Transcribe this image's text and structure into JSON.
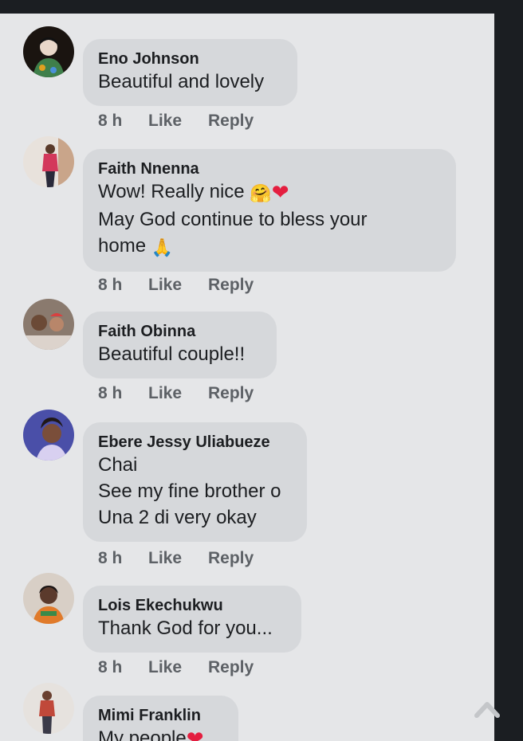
{
  "comments": [
    {
      "name": "Eno Johnson",
      "lines": [
        "Beautiful and lovely"
      ],
      "time": "8 h",
      "like": "Like",
      "reply": "Reply"
    },
    {
      "name": "Faith Nnenna",
      "lines": [
        "Wow! Really nice",
        "May God continue to bless your",
        "home"
      ],
      "time": "8 h",
      "like": "Like",
      "reply": "Reply"
    },
    {
      "name": "Faith Obinna",
      "lines": [
        "Beautiful couple!!"
      ],
      "time": "8 h",
      "like": "Like",
      "reply": "Reply"
    },
    {
      "name": "Ebere Jessy Uliabueze",
      "lines": [
        "Chai",
        "See my fine brother o",
        "Una 2 di very okay"
      ],
      "time": "8 h",
      "like": "Like",
      "reply": "Reply"
    },
    {
      "name": "Lois Ekechukwu",
      "lines": [
        "Thank God for you..."
      ],
      "time": "8 h",
      "like": "Like",
      "reply": "Reply"
    },
    {
      "name": "Mimi Franklin",
      "lines": [
        "My people"
      ]
    }
  ],
  "emojis": {
    "hug": "🤗",
    "heart": "❤",
    "pray": "🙏"
  },
  "colors": {
    "background": "#e5e6e8",
    "bubble": "#d6d8db",
    "text": "#1c1e21",
    "meta": "#5d6166",
    "heart": "#e41e3f"
  }
}
